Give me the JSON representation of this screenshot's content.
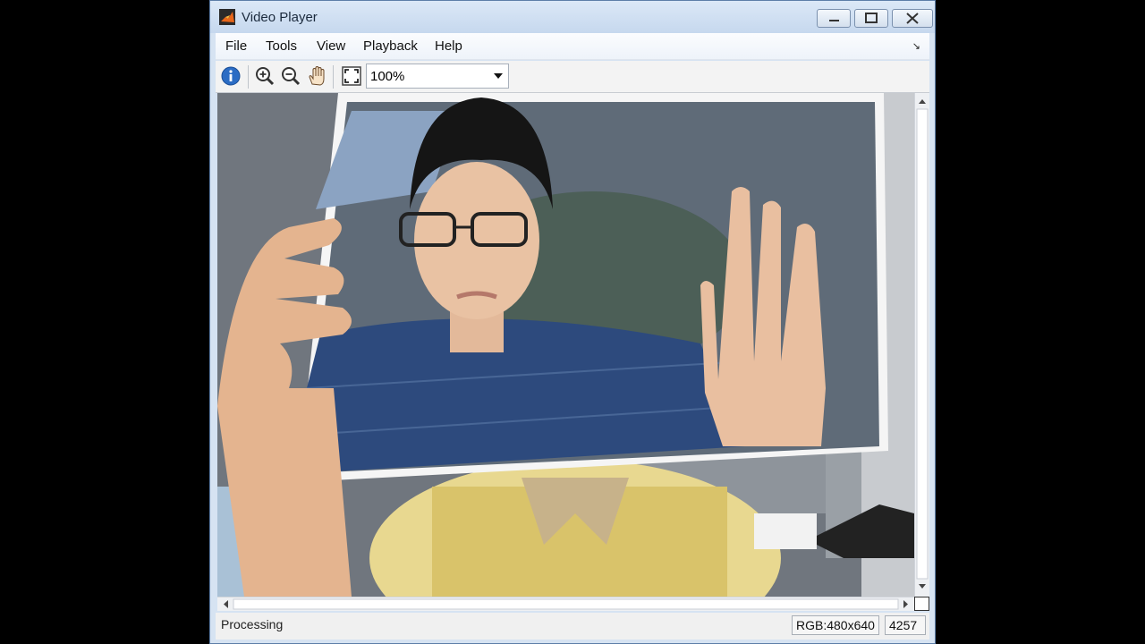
{
  "window": {
    "title": "Video Player"
  },
  "menu": {
    "items": [
      "File",
      "Tools",
      "View",
      "Playback",
      "Help"
    ],
    "expand_icon": "↘"
  },
  "toolbar": {
    "icons": [
      "info-icon",
      "zoom-in-icon",
      "zoom-out-icon",
      "pan-hand-icon",
      "fit-to-window-icon"
    ],
    "zoom_value": "100%"
  },
  "status": {
    "text": "Processing",
    "format": "RGB:480x640",
    "frame": "4257"
  },
  "colors": {
    "titlebar": "#c6d8ee",
    "window_border": "#5d7ea8",
    "info_icon": "#2b6cc4"
  }
}
